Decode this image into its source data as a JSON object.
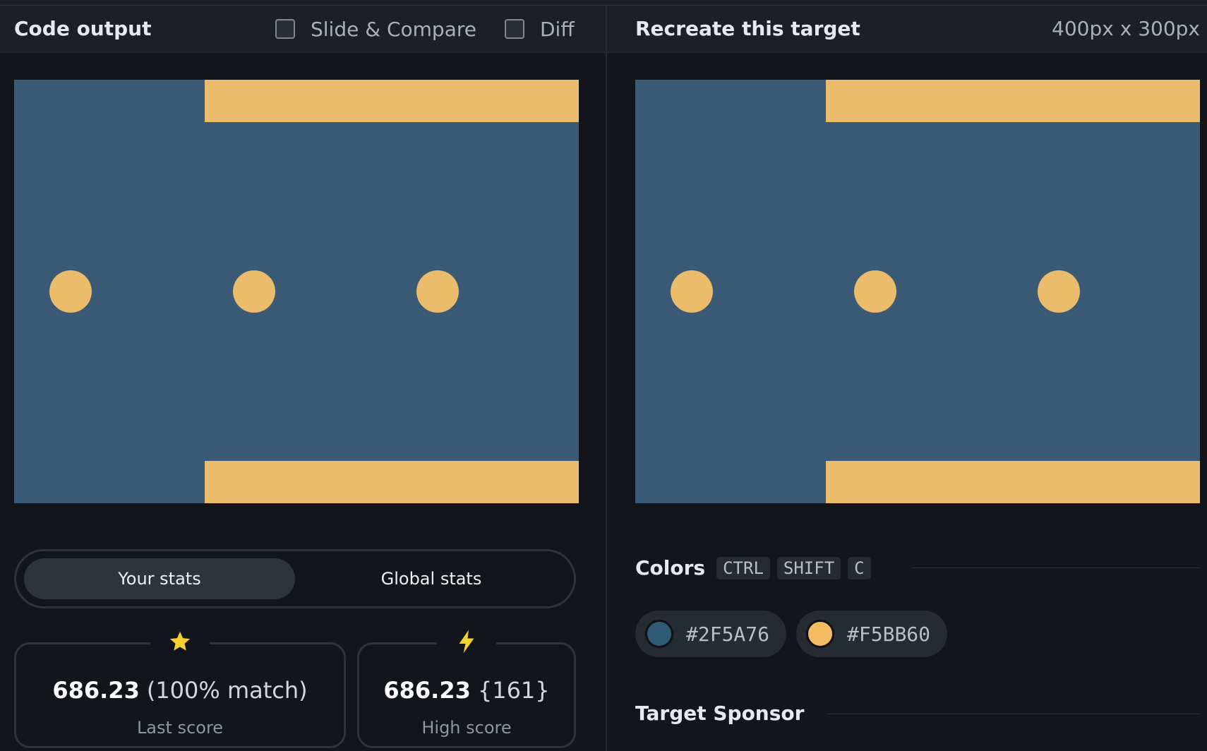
{
  "left": {
    "title": "Code output",
    "slide_compare_label": "Slide & Compare",
    "diff_label": "Diff"
  },
  "right": {
    "title": "Recreate this target",
    "size_label": "400px x 300px"
  },
  "stats": {
    "tabs": [
      {
        "label": "Your stats",
        "active": true
      },
      {
        "label": "Global stats",
        "active": false
      }
    ],
    "last": {
      "icon": "star-icon",
      "value": "686.23",
      "extra": "(100% match)",
      "label": "Last score"
    },
    "high": {
      "icon": "lightning-icon",
      "value": "686.23",
      "extra": "{161}",
      "label": "High score"
    }
  },
  "colors": {
    "title": "Colors",
    "shortcut": [
      "CTRL",
      "SHIFT",
      "C"
    ],
    "swatches": [
      {
        "hex": "#2F5A76"
      },
      {
        "hex": "#F5BB60"
      }
    ]
  },
  "sponsor": {
    "title": "Target Sponsor"
  },
  "palette": {
    "canvas_bg": "#3a5a76",
    "canvas_accent": "#ecbc6d",
    "star": "#f4d12f",
    "bolt": "#f4d12f"
  }
}
